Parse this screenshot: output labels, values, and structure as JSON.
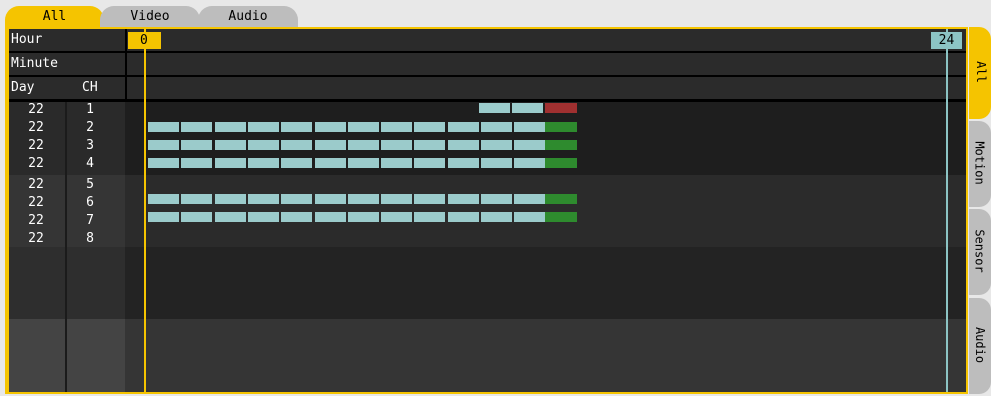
{
  "top_tabs": [
    {
      "label": "All",
      "active": true
    },
    {
      "label": "Video",
      "active": false
    },
    {
      "label": "Audio",
      "active": false
    }
  ],
  "header": {
    "hour_label": "Hour",
    "minute_label": "Minute",
    "day_label": "Day",
    "ch_label": "CH",
    "start_hour": "0",
    "end_hour": "24"
  },
  "rows": [
    {
      "day": "22",
      "ch": "1"
    },
    {
      "day": "22",
      "ch": "2"
    },
    {
      "day": "22",
      "ch": "3"
    },
    {
      "day": "22",
      "ch": "4"
    },
    {
      "day": "22",
      "ch": "5"
    },
    {
      "day": "22",
      "ch": "6"
    },
    {
      "day": "22",
      "ch": "7"
    },
    {
      "day": "22",
      "ch": "8"
    }
  ],
  "right_tabs": [
    {
      "label": "All",
      "active": true
    },
    {
      "label": "Motion",
      "active": false
    },
    {
      "label": "Sensor",
      "active": false
    },
    {
      "label": "Audio",
      "active": false
    }
  ],
  "colors": {
    "accent": "#f5c400",
    "video_segment": "#9bcbcb",
    "motion_segment": "#2e8b2e",
    "red_segment": "#a03030",
    "end_marker": "#8cc4c4"
  }
}
